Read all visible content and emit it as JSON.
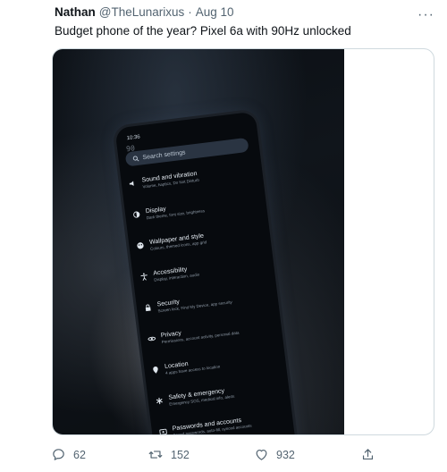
{
  "tweet": {
    "author_name": "Nathan",
    "handle": "@TheLunarixus",
    "separator": "·",
    "date": "Aug 10",
    "more_label": "···",
    "text": "Budget phone of the year? Pixel 6a with 90Hz unlocked"
  },
  "phone_screen": {
    "status_time": "10:36",
    "fps_overlay": "90",
    "search_placeholder": "Search settings",
    "items": [
      {
        "title": "Sound and vibration",
        "subtitle": "Volume, haptics, Do Not Disturb",
        "icon": "volume-icon"
      },
      {
        "title": "Display",
        "subtitle": "Dark theme, font size, brightness",
        "icon": "brightness-icon"
      },
      {
        "title": "Wallpaper and style",
        "subtitle": "Colours, themed icons, app grid",
        "icon": "palette-icon"
      },
      {
        "title": "Accessibility",
        "subtitle": "Display, interaction, audio",
        "icon": "accessibility-icon"
      },
      {
        "title": "Security",
        "subtitle": "Screen lock, Find My Device, app security",
        "icon": "lock-icon"
      },
      {
        "title": "Privacy",
        "subtitle": "Permissions, account activity, personal data",
        "icon": "eye-icon"
      },
      {
        "title": "Location",
        "subtitle": "4 apps have access to location",
        "icon": "location-icon"
      },
      {
        "title": "Safety & emergency",
        "subtitle": "Emergency SOS, medical info, alerts",
        "icon": "asterisk-icon"
      },
      {
        "title": "Passwords and accounts",
        "subtitle": "Saved passwords, auto-fill, synced accounts",
        "icon": "account-icon"
      }
    ]
  },
  "actions": {
    "replies": "62",
    "retweets": "152",
    "likes": "932"
  },
  "colors": {
    "text_primary": "#0f1419",
    "text_muted": "#536471",
    "border": "#cfd9de"
  }
}
